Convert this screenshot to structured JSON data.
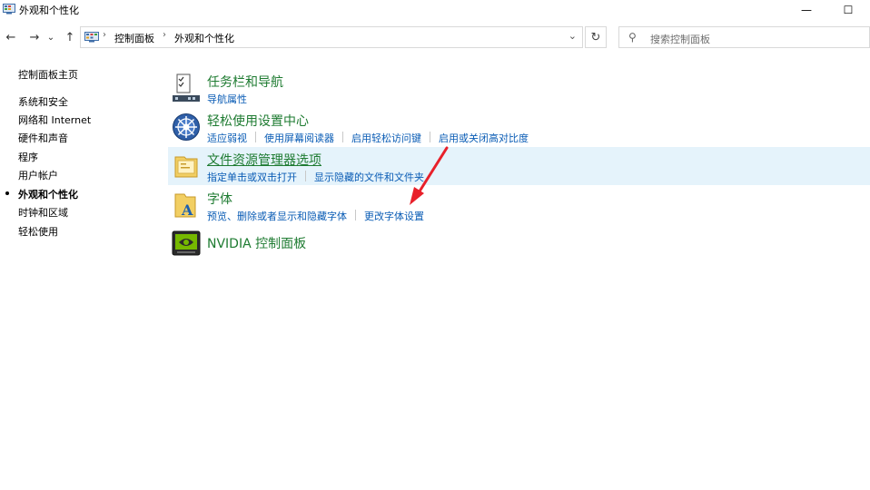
{
  "window": {
    "title": "外观和个性化",
    "minimize_glyph": "—",
    "maximize_glyph": "☐"
  },
  "navigation": {
    "back_glyph": "←",
    "forward_glyph": "→",
    "recent_glyph": "⌄",
    "up_glyph": "↑",
    "breadcrumb": [
      "控制面板",
      "外观和个性化"
    ],
    "separator_glyph": "›",
    "dropdown_glyph": "⌄",
    "refresh_glyph": "↻",
    "search_placeholder": "搜索控制面板",
    "search_glyph": "⚲"
  },
  "sidebar": {
    "home": "控制面板主页",
    "items": [
      {
        "label": "系统和安全",
        "active": false
      },
      {
        "label": "网络和 Internet",
        "active": false
      },
      {
        "label": "硬件和声音",
        "active": false
      },
      {
        "label": "程序",
        "active": false
      },
      {
        "label": "用户帐户",
        "active": false
      },
      {
        "label": "外观和个性化",
        "active": true
      },
      {
        "label": "时钟和区域",
        "active": false
      },
      {
        "label": "轻松使用",
        "active": false
      }
    ]
  },
  "categories": [
    {
      "title": "任务栏和导航",
      "icon": "taskbar-icon",
      "links": [
        "导航属性"
      ],
      "highlighted": false
    },
    {
      "title": "轻松使用设置中心",
      "icon": "ease-of-access-icon",
      "links": [
        "适应弱视",
        "使用屏幕阅读器",
        "启用轻松访问键",
        "启用或关闭高对比度"
      ],
      "highlighted": false
    },
    {
      "title": "文件资源管理器选项",
      "icon": "folder-options-icon",
      "links": [
        "指定单击或双击打开",
        "显示隐藏的文件和文件夹"
      ],
      "highlighted": true
    },
    {
      "title": "字体",
      "icon": "fonts-icon",
      "links": [
        "预览、删除或者显示和隐藏字体",
        "更改字体设置"
      ],
      "highlighted": false
    },
    {
      "title": "NVIDIA 控制面板",
      "icon": "nvidia-icon",
      "links": [],
      "highlighted": false
    }
  ],
  "colors": {
    "category_title": "#1e7b31",
    "link": "#0a5cb5",
    "highlight_bg": "#e5f3fb",
    "annotation_arrow": "#e8202a"
  }
}
